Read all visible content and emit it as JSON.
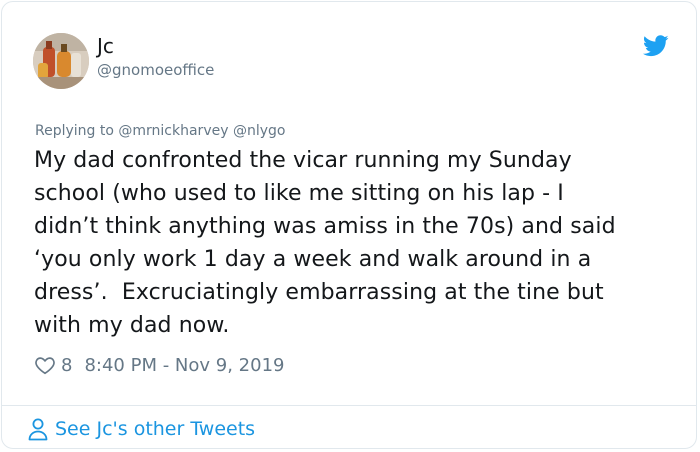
{
  "user": {
    "display_name": "Jc",
    "handle": "@gnomoeoffice",
    "avatar_icon": "avatar-photo"
  },
  "brand": {
    "logo_icon": "twitter-bird-icon",
    "accent_color": "#1da1f2"
  },
  "reply": {
    "prefix": "Replying to",
    "mentions": [
      "@mrnickharvey",
      "@nlygo"
    ]
  },
  "tweet": {
    "lines": [
      "My dad confronted the vicar running my Sunday",
      "school (who used to like me sitting on his lap - I",
      "didn’t think anything was amiss in the 70s) and said",
      "‘you only work 1 day a week and walk around in a",
      "dress’.  Excruciatingly embarrassing at the tine but",
      "with my dad now."
    ]
  },
  "meta": {
    "like_icon": "heart-icon",
    "like_count": "8",
    "timestamp": "8:40 PM - Nov 9, 2019"
  },
  "footer": {
    "icon": "person-icon",
    "link_label": "See Jc's other Tweets",
    "link_color": "#1b95e0"
  }
}
